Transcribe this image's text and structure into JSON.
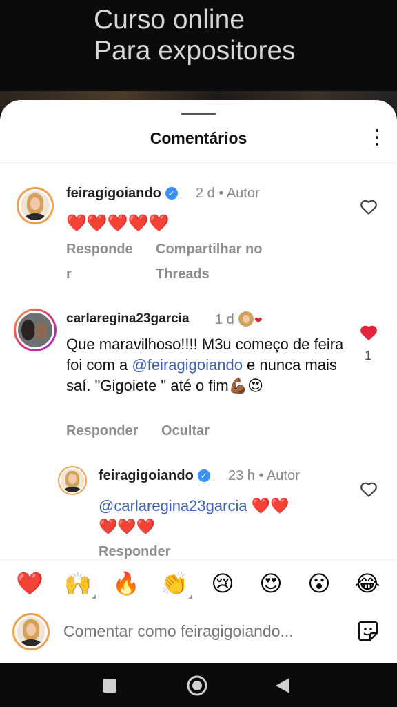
{
  "video": {
    "caption_line1": "Curso online",
    "caption_line2": "Para expositores"
  },
  "sheet": {
    "title": "Comentários"
  },
  "comments": [
    {
      "username": "feiragigoiando",
      "time": "2 d",
      "author_tag": "Autor",
      "text": "❤️❤️❤️❤️❤️",
      "reply_label": "Responde\nr",
      "share_label": "Compartilhar no\nThreads"
    },
    {
      "username": "carlaregina23garcia",
      "time": "1 d",
      "text_part1": "Que maravilhoso!!!! M3u começo de feira foi com a ",
      "mention": "@feiragigoiando",
      "text_part2": " e nunca mais saí. \"Gigoiete \" até o fim💪🏾😍",
      "like_count": "1",
      "reply_label": "Responder",
      "hide_label": "Ocultar"
    }
  ],
  "reply": {
    "username": "feiragigoiando",
    "time": "23 h",
    "author_tag": "Autor",
    "mention": "@carlaregina23garcia",
    "hearts_inline": "❤️❤️",
    "hearts_next": "❤️❤️❤️",
    "reply_label": "Responder"
  },
  "reactions": [
    "❤️",
    "🙌",
    "🔥",
    "👏",
    "😢",
    "😍",
    "😮",
    "😂"
  ],
  "composer": {
    "placeholder": "Comentar como feiragigoiando..."
  },
  "colors": {
    "accent_blue": "#3b5fbf",
    "heart_red": "#e4233c",
    "verified_blue": "#3a8ff5"
  }
}
